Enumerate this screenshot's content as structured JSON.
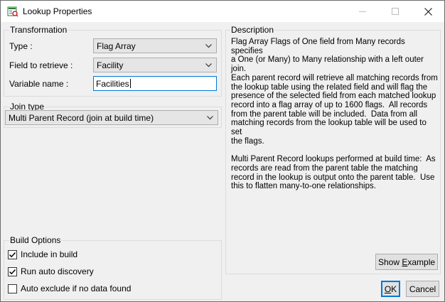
{
  "window": {
    "title": "Lookup Properties"
  },
  "transformation": {
    "group_label": "Transformation",
    "type_label": "Type :",
    "type_value": "Flag Array",
    "field_label": "Field to retrieve :",
    "field_value": "Facility",
    "varname_label": "Variable name :",
    "varname_value": "Facilities"
  },
  "join_type": {
    "group_label": "Join type",
    "value": "Multi Parent Record (join at build time)"
  },
  "build_options": {
    "group_label": "Build Options",
    "items": [
      {
        "label": "Include in build",
        "checked": true
      },
      {
        "label": "Run auto discovery",
        "checked": true
      },
      {
        "label": "Auto exclude if no data found",
        "checked": false
      }
    ]
  },
  "description": {
    "group_label": "Description",
    "text": "Flag Array Flags of One field from Many records specifies\na One (or Many) to Many relationship with a left outer join.\nEach parent record will retrieve all matching records from\nthe lookup table using the related field and will flag the\npresence of the selected field from each matched lookup\nrecord into a flag array of up to 1600 flags.  All records\nfrom the parent table will be included.  Data from all\nmatching records from the lookup table will be used to set\nthe flags.\n\nMulti Parent Record lookups performed at build time:  As\nrecords are read from the parent table the matching\nrecord in the lookup is output onto the parent table.  Use\nthis to flatten many-to-one relationships."
  },
  "buttons": {
    "show_example_pre": "Show ",
    "show_example_accel": "E",
    "show_example_post": "xample",
    "ok_accel": "O",
    "ok_post": "K",
    "cancel": "Cancel"
  }
}
